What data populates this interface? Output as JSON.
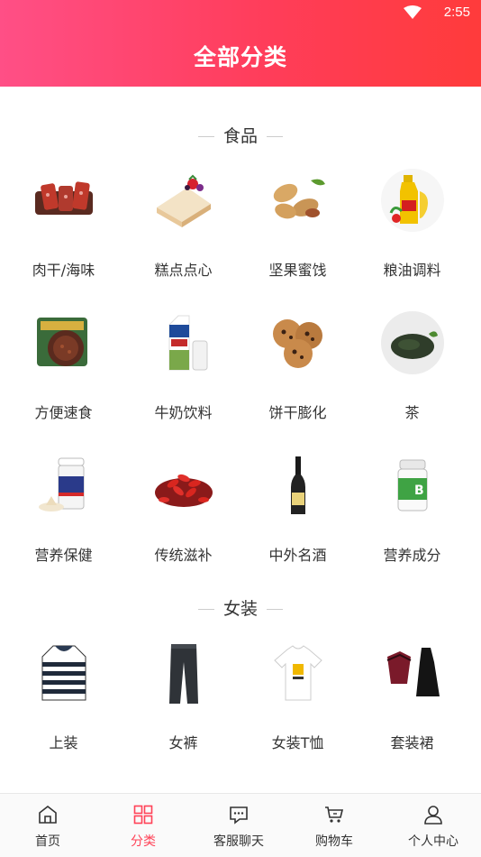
{
  "status_bar": {
    "time": "2:55"
  },
  "header": {
    "title": "全部分类"
  },
  "sections": [
    {
      "title": "食品",
      "items": [
        {
          "label": "肉干/海味",
          "icon": "jerky-icon"
        },
        {
          "label": "糕点点心",
          "icon": "cake-icon"
        },
        {
          "label": "坚果蜜饯",
          "icon": "peanut-icon"
        },
        {
          "label": "粮油调料",
          "icon": "oil-bottle-icon"
        },
        {
          "label": "方便速食",
          "icon": "instant-rice-icon"
        },
        {
          "label": "牛奶饮料",
          "icon": "milk-carton-icon"
        },
        {
          "label": "饼干膨化",
          "icon": "cookie-icon"
        },
        {
          "label": "茶",
          "icon": "tea-leaves-icon"
        },
        {
          "label": "营养保健",
          "icon": "powder-can-icon"
        },
        {
          "label": "传统滋补",
          "icon": "goji-berry-icon"
        },
        {
          "label": "中外名酒",
          "icon": "wine-bottle-icon"
        },
        {
          "label": "营养成分",
          "icon": "vitamin-bottle-icon"
        }
      ]
    },
    {
      "title": "女装",
      "items": [
        {
          "label": "上装",
          "icon": "striped-hoodie-icon"
        },
        {
          "label": "女裤",
          "icon": "jeans-icon"
        },
        {
          "label": "女装T恤",
          "icon": "tshirt-icon"
        },
        {
          "label": "套装裙",
          "icon": "dress-set-icon"
        }
      ]
    }
  ],
  "tabbar": {
    "tabs": [
      {
        "label": "首页",
        "icon": "home-icon"
      },
      {
        "label": "分类",
        "icon": "grid-icon"
      },
      {
        "label": "客服聊天",
        "icon": "chat-icon"
      },
      {
        "label": "购物车",
        "icon": "cart-icon"
      },
      {
        "label": "个人中心",
        "icon": "user-icon"
      }
    ],
    "active_index": 1
  },
  "colors": {
    "header_gradient_start": "#ff4f86",
    "header_gradient_end": "#ff3b3b",
    "active_tab": "#ff4257"
  }
}
